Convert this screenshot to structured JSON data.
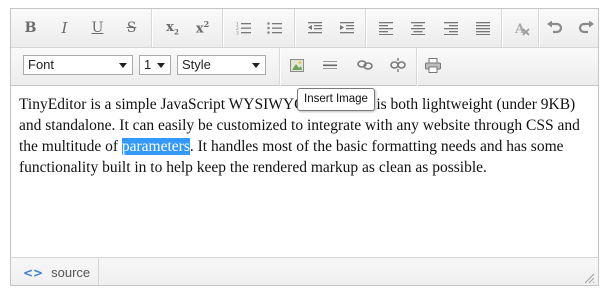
{
  "toolbar": {
    "row1_buttons": [
      {
        "name": "bold-button",
        "glyph": "B",
        "icon": "bold-icon"
      },
      {
        "name": "italic-button",
        "glyph": "I",
        "icon": "italic-icon"
      },
      {
        "name": "underline-button",
        "glyph": "U",
        "icon": "underline-icon"
      },
      {
        "name": "strikethrough-button",
        "glyph": "S",
        "icon": "strikethrough-icon"
      },
      {
        "name": "subscript-button",
        "glyph": "x",
        "icon": "subscript-icon"
      },
      {
        "name": "superscript-button",
        "glyph": "x",
        "icon": "superscript-icon"
      },
      {
        "name": "ordered-list-button",
        "icon": "ordered-list-icon"
      },
      {
        "name": "unordered-list-button",
        "icon": "unordered-list-icon"
      },
      {
        "name": "outdent-button",
        "icon": "outdent-icon"
      },
      {
        "name": "indent-button",
        "icon": "indent-icon"
      },
      {
        "name": "align-left-button",
        "icon": "align-left-icon"
      },
      {
        "name": "align-center-button",
        "icon": "align-center-icon"
      },
      {
        "name": "align-right-button",
        "icon": "align-right-icon"
      },
      {
        "name": "justify-button",
        "icon": "justify-icon"
      },
      {
        "name": "remove-format-button",
        "icon": "remove-format-icon"
      },
      {
        "name": "undo-button",
        "icon": "undo-icon"
      },
      {
        "name": "redo-button",
        "icon": "redo-icon"
      }
    ],
    "font_select": "Font",
    "size_select": "1",
    "style_select": "Style",
    "row2_buttons": [
      {
        "name": "insert-image-button",
        "icon": "image-icon"
      },
      {
        "name": "horizontal-rule-button",
        "icon": "horizontal-rule-icon"
      },
      {
        "name": "insert-link-button",
        "icon": "link-icon"
      },
      {
        "name": "unlink-button",
        "icon": "unlink-icon"
      },
      {
        "name": "print-button",
        "icon": "print-icon"
      }
    ]
  },
  "tooltip": "Insert Image",
  "content": {
    "before": "TinyEditor is a simple JavaScript WYSIWYG editor that is both lightweight (under 9KB) and standalone. It can easily be customized to integrate with any website through CSS and the multitude of ",
    "selected": "parameters",
    "after": ". It handles most of the basic formatting needs and has some functionality built in to help keep the rendered markup as clean as possible."
  },
  "footer": {
    "source_label": "source",
    "source_icon": "<>"
  },
  "colors": {
    "selection": "#3399ff",
    "source_icon": "#3a7fd5"
  }
}
